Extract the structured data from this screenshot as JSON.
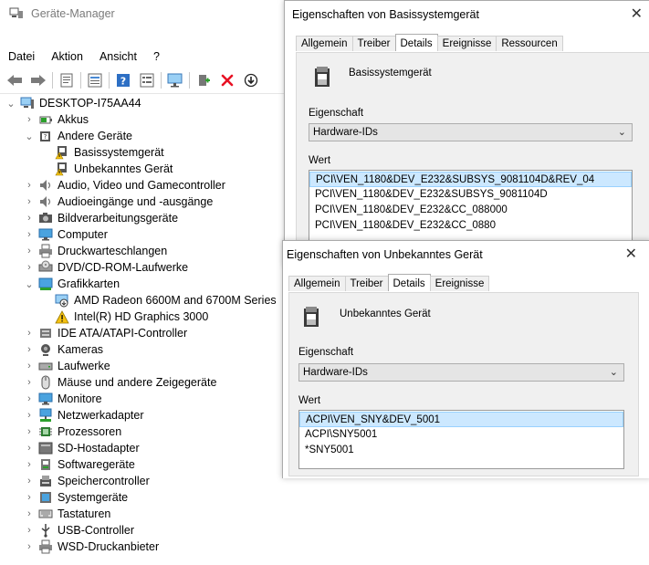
{
  "devmgr": {
    "title": "Geräte-Manager",
    "menu": [
      "Datei",
      "Aktion",
      "Ansicht",
      "?"
    ],
    "toolbar_icons": [
      "back-arrow-icon",
      "forward-arrow-icon",
      "properties-icon",
      "list-icon",
      "help-icon",
      "list-view-icon",
      "monitor-scan-icon",
      "add-driver-icon",
      "uninstall-x-icon",
      "update-driver-icon"
    ],
    "tree": [
      {
        "label": "DESKTOP-I75AA44",
        "level": 0,
        "expander": "open",
        "icon": "computer-icon"
      },
      {
        "label": "Akkus",
        "level": 1,
        "expander": "closed",
        "icon": "battery-icon"
      },
      {
        "label": "Andere Geräte",
        "level": 1,
        "expander": "open",
        "icon": "unknown-devices-icon"
      },
      {
        "label": "Basissystemgerät",
        "level": 2,
        "expander": "none",
        "icon": "warning-device-icon"
      },
      {
        "label": "Unbekanntes Gerät",
        "level": 2,
        "expander": "none",
        "icon": "warning-device-icon"
      },
      {
        "label": "Audio, Video und Gamecontroller",
        "level": 1,
        "expander": "closed",
        "icon": "speaker-icon"
      },
      {
        "label": "Audioeingänge und -ausgänge",
        "level": 1,
        "expander": "closed",
        "icon": "speaker-icon"
      },
      {
        "label": "Bildverarbeitungsgeräte",
        "level": 1,
        "expander": "closed",
        "icon": "camera-icon"
      },
      {
        "label": "Computer",
        "level": 1,
        "expander": "closed",
        "icon": "monitor-icon"
      },
      {
        "label": "Druckwarteschlangen",
        "level": 1,
        "expander": "closed",
        "icon": "printer-icon"
      },
      {
        "label": "DVD/CD-ROM-Laufwerke",
        "level": 1,
        "expander": "closed",
        "icon": "disc-drive-icon"
      },
      {
        "label": "Grafikkarten",
        "level": 1,
        "expander": "open",
        "icon": "display-adapter-icon"
      },
      {
        "label": "AMD Radeon 6600M and 6700M Series",
        "level": 2,
        "expander": "none",
        "icon": "disabled-device-icon"
      },
      {
        "label": "Intel(R) HD Graphics 3000",
        "level": 2,
        "expander": "none",
        "icon": "warning-triangle-icon"
      },
      {
        "label": "IDE ATA/ATAPI-Controller",
        "level": 1,
        "expander": "closed",
        "icon": "controller-icon"
      },
      {
        "label": "Kameras",
        "level": 1,
        "expander": "closed",
        "icon": "webcam-icon"
      },
      {
        "label": "Laufwerke",
        "level": 1,
        "expander": "closed",
        "icon": "drive-icon"
      },
      {
        "label": "Mäuse und andere Zeigegeräte",
        "level": 1,
        "expander": "closed",
        "icon": "mouse-icon"
      },
      {
        "label": "Monitore",
        "level": 1,
        "expander": "closed",
        "icon": "monitor-icon"
      },
      {
        "label": "Netzwerkadapter",
        "level": 1,
        "expander": "closed",
        "icon": "network-icon"
      },
      {
        "label": "Prozessoren",
        "level": 1,
        "expander": "closed",
        "icon": "cpu-icon"
      },
      {
        "label": "SD-Hostadapter",
        "level": 1,
        "expander": "closed",
        "icon": "sd-card-icon"
      },
      {
        "label": "Softwaregeräte",
        "level": 1,
        "expander": "closed",
        "icon": "software-device-icon"
      },
      {
        "label": "Speichercontroller",
        "level": 1,
        "expander": "closed",
        "icon": "storage-controller-icon"
      },
      {
        "label": "Systemgeräte",
        "level": 1,
        "expander": "closed",
        "icon": "system-device-icon"
      },
      {
        "label": "Tastaturen",
        "level": 1,
        "expander": "closed",
        "icon": "keyboard-icon"
      },
      {
        "label": "USB-Controller",
        "level": 1,
        "expander": "closed",
        "icon": "usb-icon"
      },
      {
        "label": "WSD-Druckanbieter",
        "level": 1,
        "expander": "closed",
        "icon": "printer-icon"
      }
    ]
  },
  "dialog1": {
    "title": "Eigenschaften von Basissystemgerät",
    "close": "✕",
    "tabs": [
      "Allgemein",
      "Treiber",
      "Details",
      "Ereignisse",
      "Ressourcen"
    ],
    "active_tab": "Details",
    "device_name": "Basissystemgerät",
    "property_label": "Eigenschaft",
    "property_value": "Hardware-IDs",
    "value_label": "Wert",
    "values": [
      "PCI\\VEN_1180&DEV_E232&SUBSYS_9081104D&REV_04",
      "PCI\\VEN_1180&DEV_E232&SUBSYS_9081104D",
      "PCI\\VEN_1180&DEV_E232&CC_088000",
      "PCI\\VEN_1180&DEV_E232&CC_0880"
    ]
  },
  "dialog2": {
    "title": "Eigenschaften von Unbekanntes Gerät",
    "close": "✕",
    "tabs": [
      "Allgemein",
      "Treiber",
      "Details",
      "Ereignisse"
    ],
    "active_tab": "Details",
    "device_name": "Unbekanntes Gerät",
    "property_label": "Eigenschaft",
    "property_value": "Hardware-IDs",
    "value_label": "Wert",
    "values": [
      "ACPI\\VEN_SNY&DEV_5001",
      "ACPI\\SNY5001",
      "*SNY5001"
    ]
  },
  "colors": {
    "selection": "#cce8ff",
    "warning": "#f5c211",
    "danger": "#e81123",
    "dialog_bg": "#f0f0f0"
  }
}
